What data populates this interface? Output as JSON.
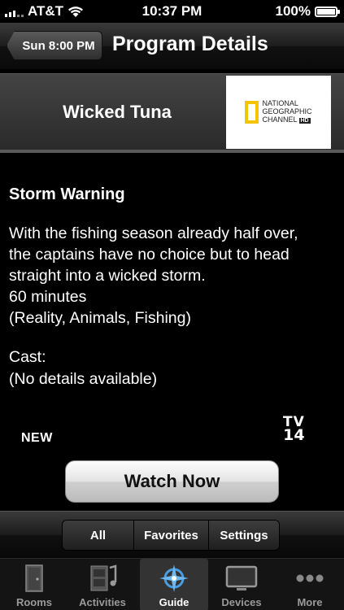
{
  "status": {
    "carrier": "AT&T",
    "time": "10:37 PM",
    "battery": "100%"
  },
  "nav": {
    "back_label": "Sun 8:00 PM",
    "title": "Program Details"
  },
  "show": {
    "title": "Wicked Tuna",
    "channel_logo_text": [
      "NATIONAL",
      "GEOGRAPHIC",
      "CHANNEL"
    ],
    "channel_hd": "HD"
  },
  "details": {
    "episode_title": "Storm Warning",
    "description_lines": [
      "With the fishing season already half over,",
      "the captains have no choice but to head",
      "straight into a wicked storm."
    ],
    "duration": "60 minutes",
    "genres": "(Reality, Animals, Fishing)",
    "cast_label": "Cast:",
    "cast_value": "(No details available)"
  },
  "badges": {
    "new": "NEW",
    "rating_line1": "TV",
    "rating_line2": "14"
  },
  "watch_button": "Watch Now",
  "filters": [
    {
      "label": "All"
    },
    {
      "label": "Favorites"
    },
    {
      "label": "Settings"
    }
  ],
  "tabs": [
    {
      "label": "Rooms",
      "icon": "door-icon"
    },
    {
      "label": "Activities",
      "icon": "film-music-icon"
    },
    {
      "label": "Guide",
      "icon": "compass-icon",
      "active": true
    },
    {
      "label": "Devices",
      "icon": "tv-icon"
    },
    {
      "label": "More",
      "icon": "ellipsis-icon"
    }
  ],
  "colors": {
    "accent_logo_frame": "#f5c400",
    "active_tab_bg": "#333333"
  }
}
